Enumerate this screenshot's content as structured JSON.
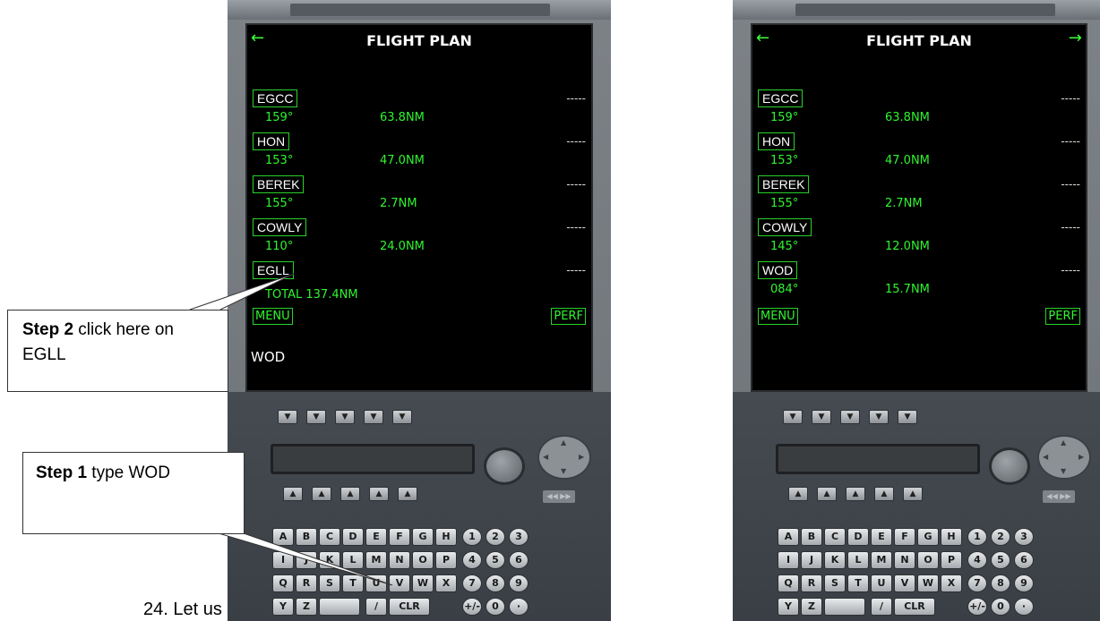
{
  "left_device": {
    "title": "FLIGHT PLAN",
    "arrow_left": "←",
    "waypoints": [
      {
        "name": "EGCC",
        "heading": "159°",
        "distance": "63.8NM",
        "dashes": "-----"
      },
      {
        "name": "HON",
        "heading": "153°",
        "distance": "47.0NM",
        "dashes": "-----"
      },
      {
        "name": "BEREK",
        "heading": "155°",
        "distance": "2.7NM",
        "dashes": "-----"
      },
      {
        "name": "COWLY",
        "heading": "110°",
        "distance": "24.0NM",
        "dashes": "-----"
      },
      {
        "name": "EGLL",
        "dashes": "-----"
      }
    ],
    "total_label": "TOTAL",
    "total_value": "137.4NM",
    "menu_label": "MENU",
    "perf_label": "PERF",
    "scratchpad": "WOD"
  },
  "right_device": {
    "title": "FLIGHT PLAN",
    "arrow_left": "←",
    "arrow_right": "→",
    "waypoints": [
      {
        "name": "EGCC",
        "heading": "159°",
        "distance": "63.8NM",
        "dashes": "-----"
      },
      {
        "name": "HON",
        "heading": "153°",
        "distance": "47.0NM",
        "dashes": "-----"
      },
      {
        "name": "BEREK",
        "heading": "155°",
        "distance": "2.7NM",
        "dashes": "-----"
      },
      {
        "name": "COWLY",
        "heading": "145°",
        "distance": "12.0NM",
        "dashes": "-----"
      },
      {
        "name": "WOD",
        "heading": "084°",
        "distance": "15.7NM",
        "dashes": "-----"
      }
    ],
    "menu_label": "MENU",
    "perf_label": "PERF"
  },
  "keypad": {
    "down_glyph": "▼",
    "up_glyph": "▲",
    "ff_glyph": "◀◀ ▶▶",
    "row1": [
      "A",
      "B",
      "C",
      "D",
      "E",
      "F",
      "G",
      "H",
      "1",
      "2",
      "3"
    ],
    "row2": [
      "I",
      "J",
      "K",
      "L",
      "M",
      "N",
      "O",
      "P",
      "4",
      "5",
      "6"
    ],
    "row3": [
      "Q",
      "R",
      "S",
      "T",
      "U",
      "V",
      "W",
      "X",
      "7",
      "8",
      "9"
    ],
    "row4": [
      "Y",
      "Z",
      "",
      "/",
      "CLR",
      "+/-",
      "0",
      "·"
    ]
  },
  "callouts": {
    "step2_bold": "Step 2",
    "step2_text": " click here on EGLL",
    "step1_bold": "Step 1",
    "step1_text": " type WOD"
  },
  "caption": "24. Let us"
}
